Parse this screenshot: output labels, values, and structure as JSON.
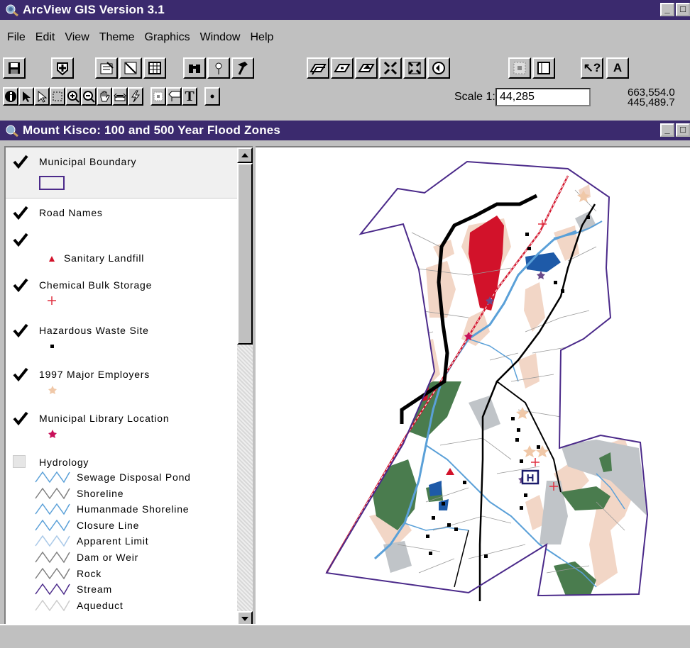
{
  "app": {
    "title": "ArcView GIS Version 3.1"
  },
  "menu": [
    "File",
    "Edit",
    "View",
    "Theme",
    "Graphics",
    "Window",
    "Help"
  ],
  "toolbar": {
    "scale_label": "Scale 1:",
    "scale_value": "44,285",
    "coord_x": "663,554.0",
    "coord_y": "445,489.7",
    "text_tool": "T",
    "label_tool": "A",
    "help_tool": "?",
    "info_tool": "i"
  },
  "view": {
    "title": "Mount Kisco: 100 and 500 Year Flood Zones"
  },
  "legend": {
    "themes": [
      {
        "label": "Municipal Boundary",
        "checked": true
      },
      {
        "label": "Road Names",
        "checked": true
      },
      {
        "label": "",
        "checked": true
      },
      {
        "label": "Sanitary Landfill",
        "checked": null
      },
      {
        "label": "Chemical Bulk Storage",
        "checked": true
      },
      {
        "label": "Hazardous Waste Site",
        "checked": true
      },
      {
        "label": "1997 Major Employers",
        "checked": true
      },
      {
        "label": "Municipal Library Location",
        "checked": true
      },
      {
        "label": "Hydrology",
        "checked": false
      }
    ],
    "hydrology_classes": [
      "Sewage Disposal Pond",
      "Shoreline",
      "Humanmade Shoreline",
      "Closure Line",
      "Apparent Limit",
      "Dam or Weir",
      "Rock",
      "Stream",
      "Aqueduct"
    ]
  },
  "map": {
    "hospital_label": "H"
  },
  "colors": {
    "titlebar": "#3b2a6e",
    "boundary": "#4b2a8a",
    "flood_500": "#f2d6c6",
    "flood_100": "#c0c4c8",
    "landfill": "#d2122a",
    "wetland": "#4a7c4e",
    "water": "#1e5aa8",
    "stream": "#5aa0d8",
    "library": "#c8105a",
    "employer": "#f0c8a8"
  }
}
